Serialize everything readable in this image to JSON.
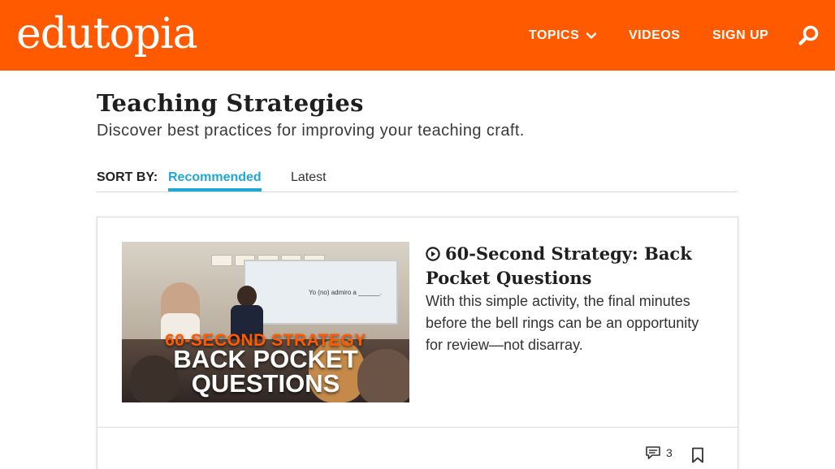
{
  "header": {
    "logo": "edutopia",
    "nav": {
      "topics": "TOPICS",
      "videos": "VIDEOS",
      "signup": "SIGN UP"
    },
    "icons": {
      "topics_chevron": "chevron-down-icon",
      "search": "search-icon"
    },
    "brand_color": "#ff5a00"
  },
  "page": {
    "title": "Teaching Strategies",
    "subtitle": "Discover best practices for improving your teaching craft."
  },
  "sort": {
    "label": "SORT BY:",
    "options": [
      "Recommended",
      "Latest"
    ],
    "selected": "Recommended",
    "accent_color": "#1fa8d6"
  },
  "card": {
    "thumbnail": {
      "line1": "60-SECOND STRATEGY",
      "line2": "BACK POCKET",
      "line3": "QUESTIONS",
      "board_text": "Yo (no) admiro a ______."
    },
    "title": "60-Second Strategy: Back Pocket Questions",
    "title_icon": "play-circle-icon",
    "description": "With this simple activity, the final minutes before the bell rings can be an opportunity for review—not disarray.",
    "comment_count": "3",
    "icons": {
      "comments": "comment-icon",
      "bookmark": "bookmark-icon"
    }
  }
}
